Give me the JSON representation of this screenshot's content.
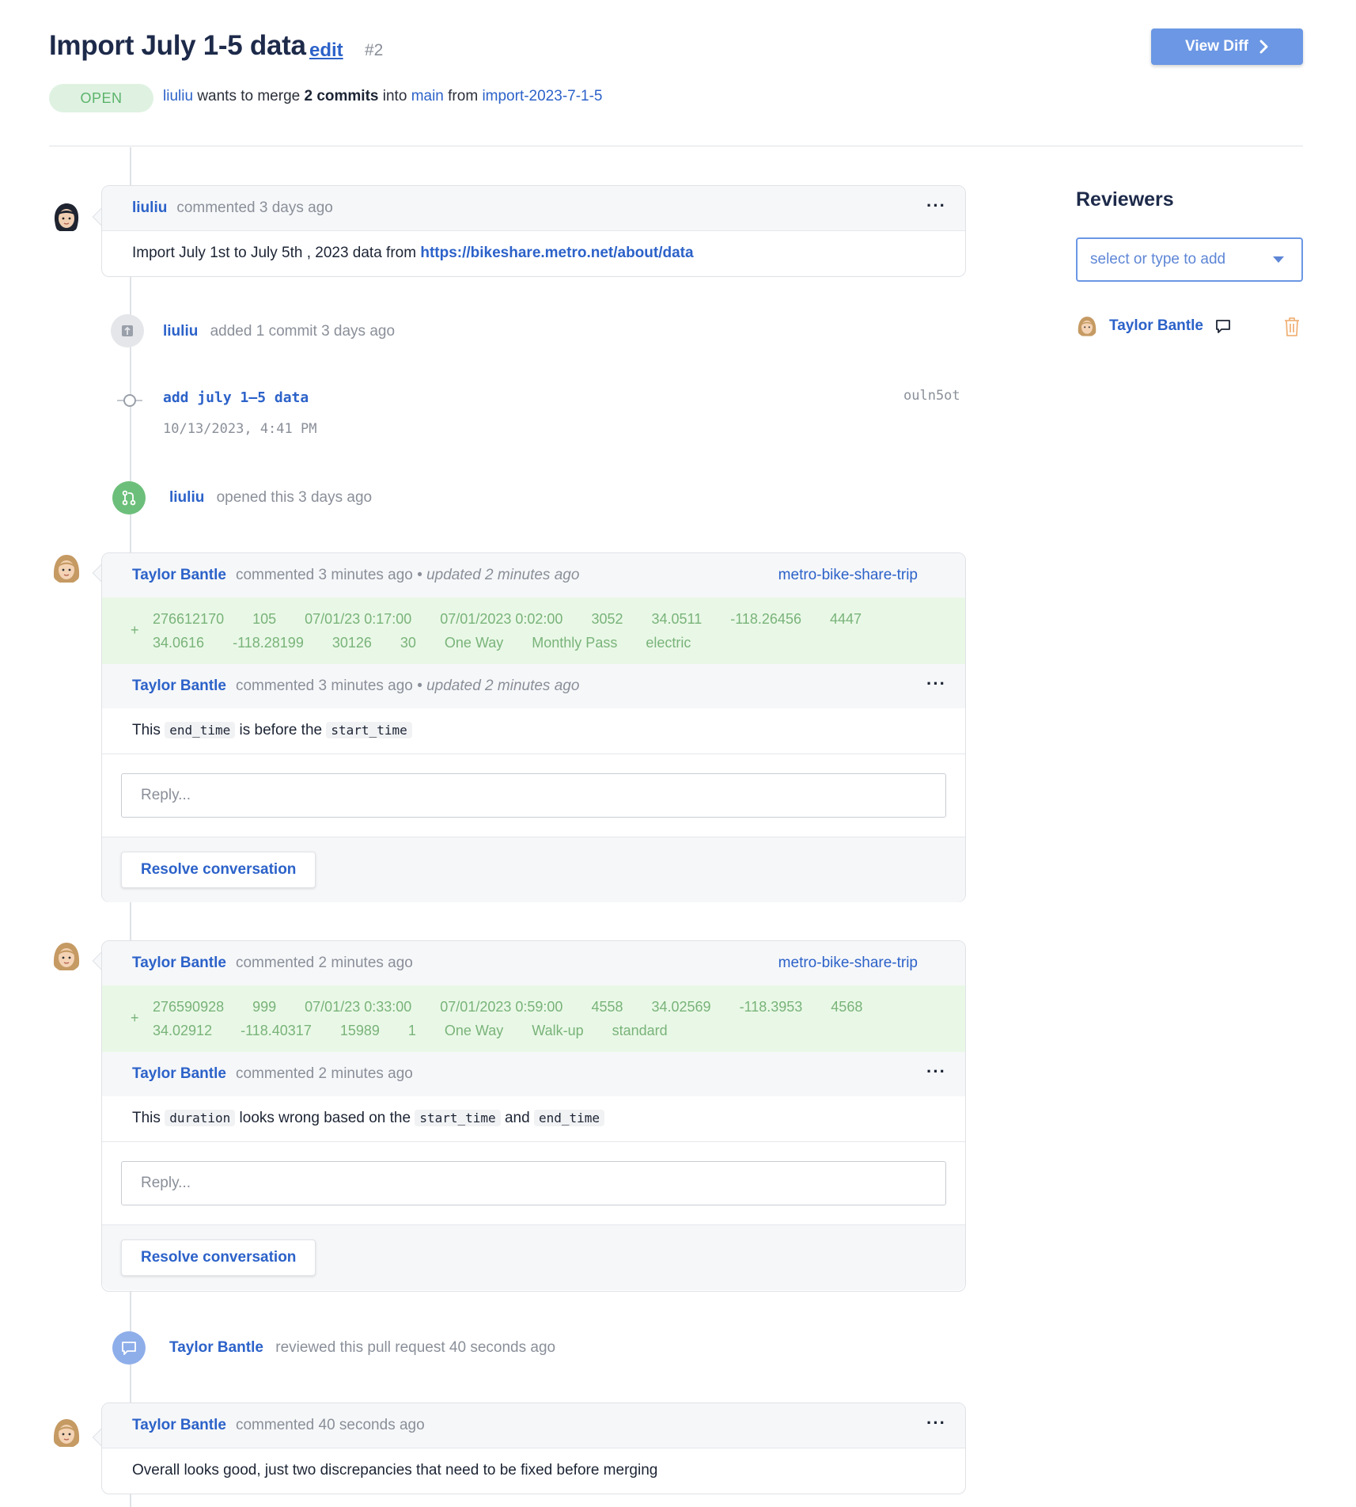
{
  "header": {
    "title": "Import July 1-5 data",
    "edit_label": "edit",
    "number": "#2",
    "view_diff_label": "View Diff",
    "status": "OPEN",
    "merge": {
      "author": "liuliu",
      "text_wants": "wants to merge",
      "commit_count": "2 commits",
      "text_into": "into",
      "target": "main",
      "text_from": "from",
      "source": "import-2023-7-1-5"
    }
  },
  "timeline": {
    "comment1": {
      "author": "liuliu",
      "meta": "commented 3 days ago",
      "menu": "···",
      "body_prefix": "Import July 1st to July 5th , 2023 data from",
      "body_link": "https://bikeshare.metro.net/about/data"
    },
    "commit_event": {
      "author": "liuliu",
      "text": "added 1 commit 3 days ago"
    },
    "commit": {
      "message": "add july 1–5 data",
      "date": "10/13/2023, 4:41 PM",
      "hash": "ouln5ot"
    },
    "opened_event": {
      "author": "liuliu",
      "text": "opened this 3 days ago"
    },
    "thread1": {
      "author": "Taylor Bantle",
      "meta": "commented 3 minutes ago",
      "updated": "• updated 2 minutes ago",
      "table": "metro-bike-share-trip",
      "plus": "+",
      "row1": [
        "276612170",
        "105",
        "07/01/23 0:17:00",
        "07/01/2023 0:02:00",
        "3052",
        "34.0511",
        "-118.26456",
        "4447"
      ],
      "row2": [
        "34.0616",
        "-118.28199",
        "30126",
        "30",
        "One Way",
        "Monthly Pass",
        "electric"
      ],
      "comment_author": "Taylor Bantle",
      "comment_meta": "commented 3 minutes ago",
      "comment_updated": "• updated 2 minutes ago",
      "menu": "···",
      "body": {
        "t1": "This",
        "c1": "end_time",
        "t2": "is before the",
        "c2": "start_time"
      },
      "reply_placeholder": "Reply...",
      "resolve_label": "Resolve conversation"
    },
    "thread2": {
      "author": "Taylor Bantle",
      "meta": "commented 2 minutes ago",
      "table": "metro-bike-share-trip",
      "plus": "+",
      "row1": [
        "276590928",
        "999",
        "07/01/23 0:33:00",
        "07/01/2023 0:59:00",
        "4558",
        "34.02569",
        "-118.3953",
        "4568"
      ],
      "row2": [
        "34.02912",
        "-118.40317",
        "15989",
        "1",
        "One Way",
        "Walk-up",
        "standard"
      ],
      "comment_author": "Taylor Bantle",
      "comment_meta": "commented 2 minutes ago",
      "menu": "···",
      "body": {
        "t1": "This",
        "c1": "duration",
        "t2": "looks wrong based on the",
        "c2": "start_time",
        "t3": "and",
        "c3": "end_time"
      },
      "reply_placeholder": "Reply...",
      "resolve_label": "Resolve conversation"
    },
    "review_event": {
      "author": "Taylor Bantle",
      "text": "reviewed this pull request 40 seconds ago"
    },
    "comment_last": {
      "author": "Taylor Bantle",
      "meta": "commented 40 seconds ago",
      "menu": "···",
      "body": "Overall looks good, just two discrepancies that need to be fixed before merging"
    }
  },
  "sidebar": {
    "title": "Reviewers",
    "select_placeholder": "select or type to add",
    "reviewer": "Taylor Bantle"
  },
  "colors": {
    "accent": "#2c62c9",
    "button": "#6b97e4",
    "open_bg": "#dff2e2",
    "open_text": "#5cb36b",
    "diff_bg": "#e9f8e6",
    "diff_text": "#79b37a"
  },
  "icons": {
    "avatar_liuliu": "avatar-dark-hair",
    "avatar_taylor": "avatar-blonde-hair",
    "commit_event": "commit-icon",
    "opened_event": "pull-request-icon",
    "review_event": "comment-bubble-icon",
    "reviewer_comment": "comment-outline-icon",
    "reviewer_delete": "trash-icon",
    "view_diff": "chevron-right-icon"
  }
}
